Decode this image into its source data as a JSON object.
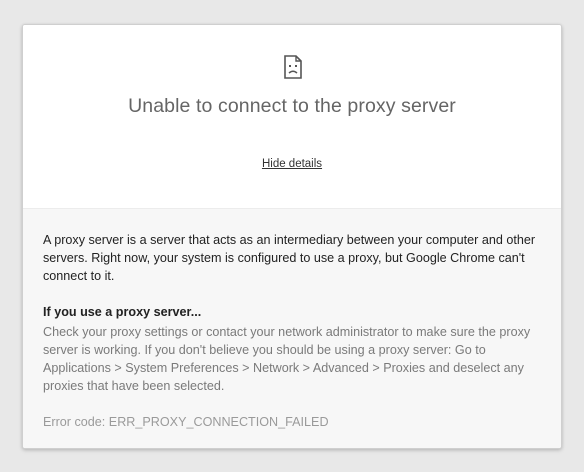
{
  "error_page": {
    "icon": "sad-page-icon",
    "title": "Unable to connect to the proxy server",
    "details_toggle_label": "Hide details",
    "description": "A proxy server is a server that acts as an intermediary between your computer and other servers. Right now, your system is configured to use a proxy, but Google Chrome can't connect to it.",
    "section_heading": "If you use a proxy server...",
    "advice": "Check your proxy settings or contact your network administrator to make sure the proxy server is working. If you don't believe you should be using a proxy server: Go to Applications > System Preferences > Network > Advanced > Proxies and deselect any proxies that have been selected.",
    "error_code": "Error code: ERR_PROXY_CONNECTION_FAILED"
  },
  "colors": {
    "page_background": "#e8e8e8",
    "card_background": "#ffffff",
    "details_background": "#f7f7f7",
    "title_text": "#656565",
    "muted_text": "#7a7a7a",
    "error_code_text": "#9a9a9a"
  }
}
